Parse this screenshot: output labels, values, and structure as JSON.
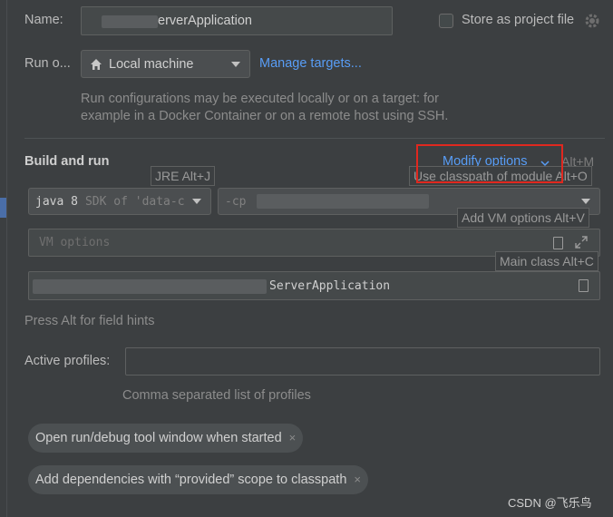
{
  "name": {
    "label": "Name:",
    "value": "erverApplication"
  },
  "store": {
    "label": "Store as project file"
  },
  "run_on": {
    "label": "Run o...",
    "selected": "Local machine",
    "manage_link": "Manage targets...",
    "hint_line1": "Run configurations may be executed locally or on a target: for",
    "hint_line2": "example in a Docker Container or on a remote host using SSH."
  },
  "build": {
    "title": "Build and run",
    "modify_options": "Modify options",
    "modify_shortcut": "Alt+M",
    "jre_tooltip": "JRE Alt+J",
    "classpath_tooltip": "Use classpath of module Alt+O",
    "vm_tooltip": "Add VM options Alt+V",
    "main_class_tooltip": "Main class Alt+C",
    "sdk_main": "java 8",
    "sdk_sub": "SDK of 'data-c",
    "cp_prefix": "-cp",
    "vm_placeholder": "VM options",
    "main_class_value": "ServerApplication",
    "field_hint": "Press Alt for field hints"
  },
  "profiles": {
    "label": "Active profiles:",
    "value": "",
    "hint": "Comma separated list of profiles"
  },
  "tags": [
    {
      "label": "Open run/debug tool window when started",
      "close": "×"
    },
    {
      "label": "Add dependencies with “provided” scope to classpath",
      "close": "×"
    }
  ],
  "watermark": "CSDN @飞乐鸟",
  "colors": {
    "background": "#3c3f41",
    "link": "#589df6",
    "highlight": "#e0281f"
  }
}
